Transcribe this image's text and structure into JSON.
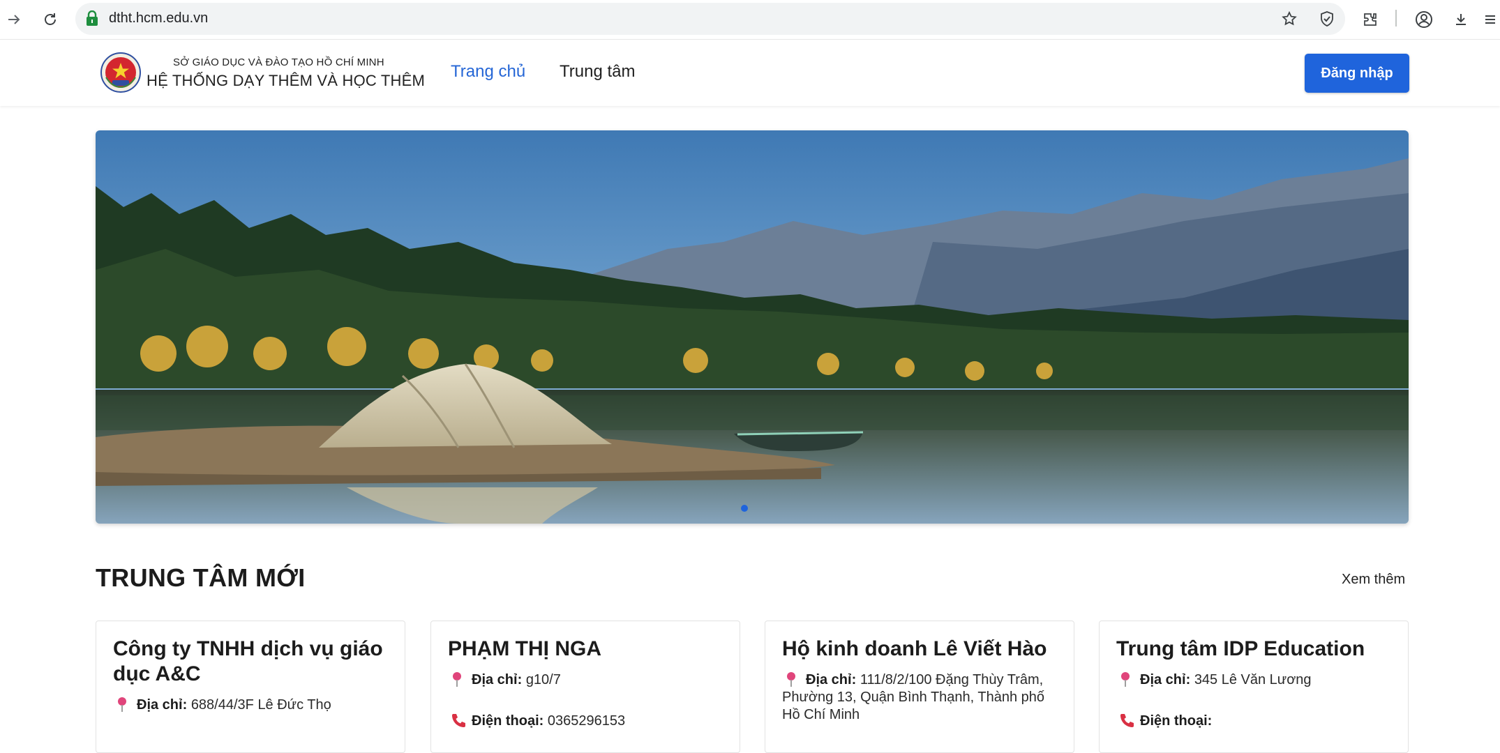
{
  "browser": {
    "url": "dtht.hcm.edu.vn"
  },
  "header": {
    "org_subtitle": "SỞ GIÁO DỤC VÀ ĐÀO TẠO HỒ CHÍ MINH",
    "org_title": "HỆ THỐNG DẠY THÊM VÀ HỌC THÊM",
    "nav": {
      "home": "Trang chủ",
      "centers": "Trung tâm"
    },
    "login_label": "Đăng nhập",
    "accent_color": "#1f64dc"
  },
  "banner": {
    "slide_count": 1,
    "active_slide": 1
  },
  "section": {
    "title": "TRUNG TÂM MỚI",
    "see_more": "Xem thêm"
  },
  "labels": {
    "address": "Địa chỉ:",
    "phone": "Điện thoại:"
  },
  "cards": [
    {
      "name": "Công ty TNHH dịch vụ giáo dục A&C",
      "address": "688/44/3F Lê Đức Thọ",
      "phone": ""
    },
    {
      "name": "PHẠM THỊ NGA",
      "address": "g10/7",
      "phone": "0365296153"
    },
    {
      "name": "Hộ kinh doanh Lê Viết Hào",
      "address": "111/8/2/100 Đặng Thùy Trâm, Phường 13, Quận Bình Thạnh, Thành phố Hồ Chí Minh",
      "phone": ""
    },
    {
      "name": "Trung tâm IDP Education",
      "address": "345 Lê Văn Lương",
      "phone": ""
    }
  ]
}
